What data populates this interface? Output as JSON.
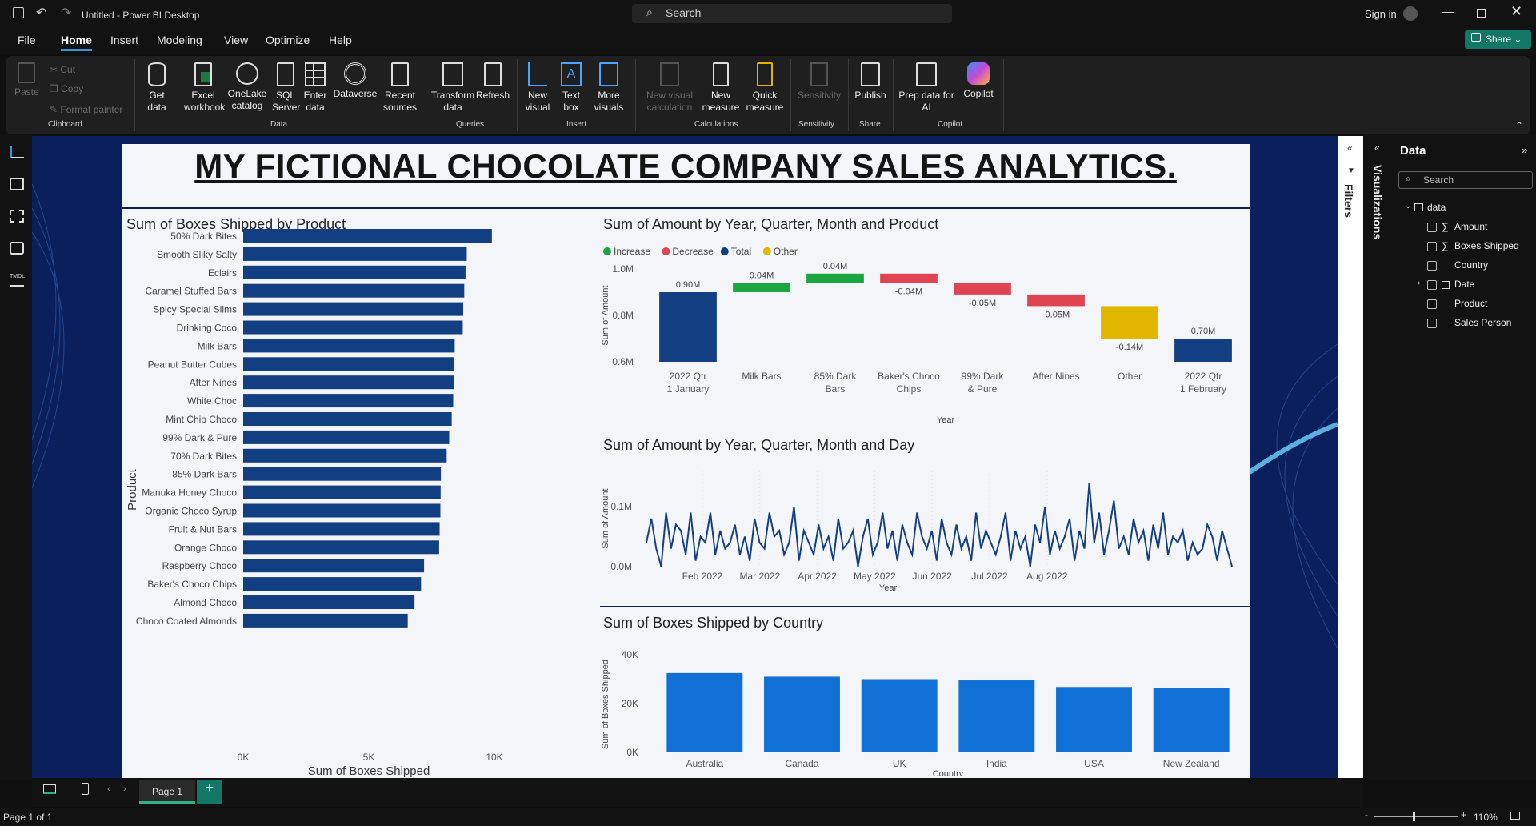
{
  "app": {
    "title": "Untitled - Power BI Desktop",
    "search_placeholder": "Search",
    "sign_in": "Sign in",
    "share": "Share"
  },
  "menu": [
    "File",
    "Home",
    "Insert",
    "Modeling",
    "View",
    "Optimize",
    "Help"
  ],
  "ribbon": {
    "clipboard": {
      "paste": "Paste",
      "cut": "Cut",
      "copy": "Copy",
      "format_painter": "Format painter",
      "group": "Clipboard"
    },
    "data": {
      "get_data": "Get data",
      "excel": "Excel workbook",
      "onelake": "OneLake catalog",
      "sql": "SQL Server",
      "enter": "Enter data",
      "dataverse": "Dataverse",
      "recent": "Recent sources",
      "group": "Data"
    },
    "queries": {
      "transform": "Transform data",
      "refresh": "Refresh",
      "group": "Queries"
    },
    "insert": {
      "new_visual": "New visual",
      "text_box": "Text box",
      "more_visuals": "More visuals",
      "group": "Insert"
    },
    "calculations": {
      "new_visual_calc": "New visual calculation",
      "new_measure": "New measure",
      "quick_measure": "Quick measure",
      "group": "Calculations"
    },
    "sensitivity": {
      "label": "Sensitivity",
      "group": "Sensitivity"
    },
    "share": {
      "publish": "Publish",
      "group": "Share"
    },
    "copilot": {
      "prep": "Prep data for AI",
      "copilot": "Copilot",
      "group": "Copilot"
    }
  },
  "report": {
    "title": "MY FICTIONAL CHOCOLATE COMPANY SALES ANALYTICS."
  },
  "chart_data": [
    {
      "type": "bar",
      "orientation": "horizontal",
      "title": "Sum of Boxes Shipped by Product",
      "xlabel": "Sum of Boxes Shipped",
      "ylabel": "Product",
      "xticks": [
        "0K",
        "5K",
        "10K"
      ],
      "xlim": [
        0,
        10000
      ],
      "color": "#123f82",
      "categories": [
        "50% Dark Bites",
        "Smooth Sliky Salty",
        "Eclairs",
        "Caramel Stuffed Bars",
        "Spicy Special Slims",
        "Drinking Coco",
        "Milk Bars",
        "Peanut Butter Cubes",
        "After Nines",
        "White Choc",
        "Mint Chip Choco",
        "99% Dark & Pure",
        "70% Dark Bites",
        "85% Dark Bars",
        "Manuka Honey Choco",
        "Organic Choco Syrup",
        "Fruit & Nut Bars",
        "Orange Choco",
        "Raspberry Choco",
        "Baker's Choco Chips",
        "Almond Choco",
        "Choco Coated Almonds"
      ],
      "values": [
        9900,
        8900,
        8850,
        8800,
        8760,
        8740,
        8420,
        8400,
        8380,
        8360,
        8300,
        8200,
        8100,
        7870,
        7860,
        7850,
        7820,
        7800,
        7200,
        7080,
        6820,
        6550
      ]
    },
    {
      "type": "waterfall",
      "title": "Sum of Amount by Year, Quarter, Month and Product",
      "xlabel": "Year",
      "ylabel": "Sum of Amount",
      "legend": [
        "Increase",
        "Decrease",
        "Total",
        "Other"
      ],
      "legend_colors": [
        "#1aa640",
        "#e04453",
        "#123f82",
        "#e2b500"
      ],
      "ylim": [
        0.6,
        1.0
      ],
      "yticks": [
        "0.6M",
        "0.8M",
        "1.0M"
      ],
      "categories": [
        "2022 Qtr 1 January",
        "Milk Bars",
        "85% Dark Bars",
        "Baker's Choco Chips",
        "99% Dark & Pure",
        "After Nines",
        "Other",
        "2022 Qtr 1 February"
      ],
      "values": [
        0.9,
        0.04,
        0.04,
        -0.04,
        -0.05,
        -0.05,
        -0.14,
        0.7
      ],
      "labels": [
        "0.90M",
        "0.04M",
        "0.04M",
        "-0.04M",
        "-0.05M",
        "-0.05M",
        "-0.14M",
        "0.70M"
      ],
      "kinds": [
        "total",
        "increase",
        "increase",
        "decrease",
        "decrease",
        "decrease",
        "other",
        "total"
      ]
    },
    {
      "type": "line",
      "title": "Sum of Amount by Year, Quarter, Month and Day",
      "xlabel": "Year",
      "ylabel": "Sum of Amount",
      "xticks": [
        "Feb 2022",
        "Mar 2022",
        "Apr 2022",
        "May 2022",
        "Jun 2022",
        "Jul 2022",
        "Aug 2022"
      ],
      "yticks": [
        "0.0M",
        "0.1M"
      ],
      "ylim": [
        0,
        0.16
      ],
      "color": "#123f82",
      "values": [
        0.04,
        0.08,
        0.03,
        0.0,
        0.09,
        0.03,
        0.07,
        0.06,
        0.02,
        0.09,
        0.01,
        0.05,
        0.04,
        0.09,
        0.02,
        0.06,
        0.03,
        0.04,
        0.07,
        0.02,
        0.05,
        0.01,
        0.08,
        0.04,
        0.03,
        0.09,
        0.05,
        0.06,
        0.02,
        0.04,
        0.1,
        0.01,
        0.06,
        0.04,
        0.02,
        0.07,
        0.03,
        0.05,
        0.01,
        0.08,
        0.03,
        0.04,
        0.06,
        0.0,
        0.05,
        0.08,
        0.02,
        0.04,
        0.09,
        0.03,
        0.06,
        0.01,
        0.07,
        0.04,
        0.02,
        0.09,
        0.05,
        0.03,
        0.06,
        0.01,
        0.08,
        0.04,
        0.02,
        0.07,
        0.03,
        0.05,
        0.01,
        0.09,
        0.03,
        0.06,
        0.04,
        0.02,
        0.05,
        0.09,
        0.01,
        0.06,
        0.03,
        0.05,
        0.0,
        0.07,
        0.04,
        0.1,
        0.02,
        0.06,
        0.03,
        0.05,
        0.08,
        0.01,
        0.06,
        0.03,
        0.14,
        0.04,
        0.09,
        0.02,
        0.06,
        0.11,
        0.03,
        0.05,
        0.02,
        0.08,
        0.04,
        0.06,
        0.01,
        0.07,
        0.03,
        0.09,
        0.02,
        0.05,
        0.04,
        0.06,
        0.01,
        0.04,
        0.02,
        0.03,
        0.07,
        0.05,
        0.01,
        0.06,
        0.03,
        0.0
      ]
    },
    {
      "type": "bar",
      "title": "Sum of Boxes Shipped by Country",
      "xlabel": "Country",
      "ylabel": "Sum of Boxes Shipped",
      "yticks": [
        "0K",
        "20K",
        "40K"
      ],
      "ylim": [
        0,
        40000
      ],
      "color": "#1170d6",
      "categories": [
        "Australia",
        "Canada",
        "UK",
        "India",
        "USA",
        "New Zealand"
      ],
      "values": [
        32500,
        31000,
        30000,
        29500,
        26800,
        26500
      ]
    }
  ],
  "side": {
    "filters": "Filters",
    "visualizations": "Visualizations",
    "data_title": "Data",
    "search_placeholder": "Search",
    "table": "data",
    "fields": [
      "Amount",
      "Boxes Shipped",
      "Country",
      "Date",
      "Product",
      "Sales Person"
    ]
  },
  "pages": {
    "tab": "Page 1",
    "status": "Page 1 of 1",
    "zoom": "110%"
  }
}
